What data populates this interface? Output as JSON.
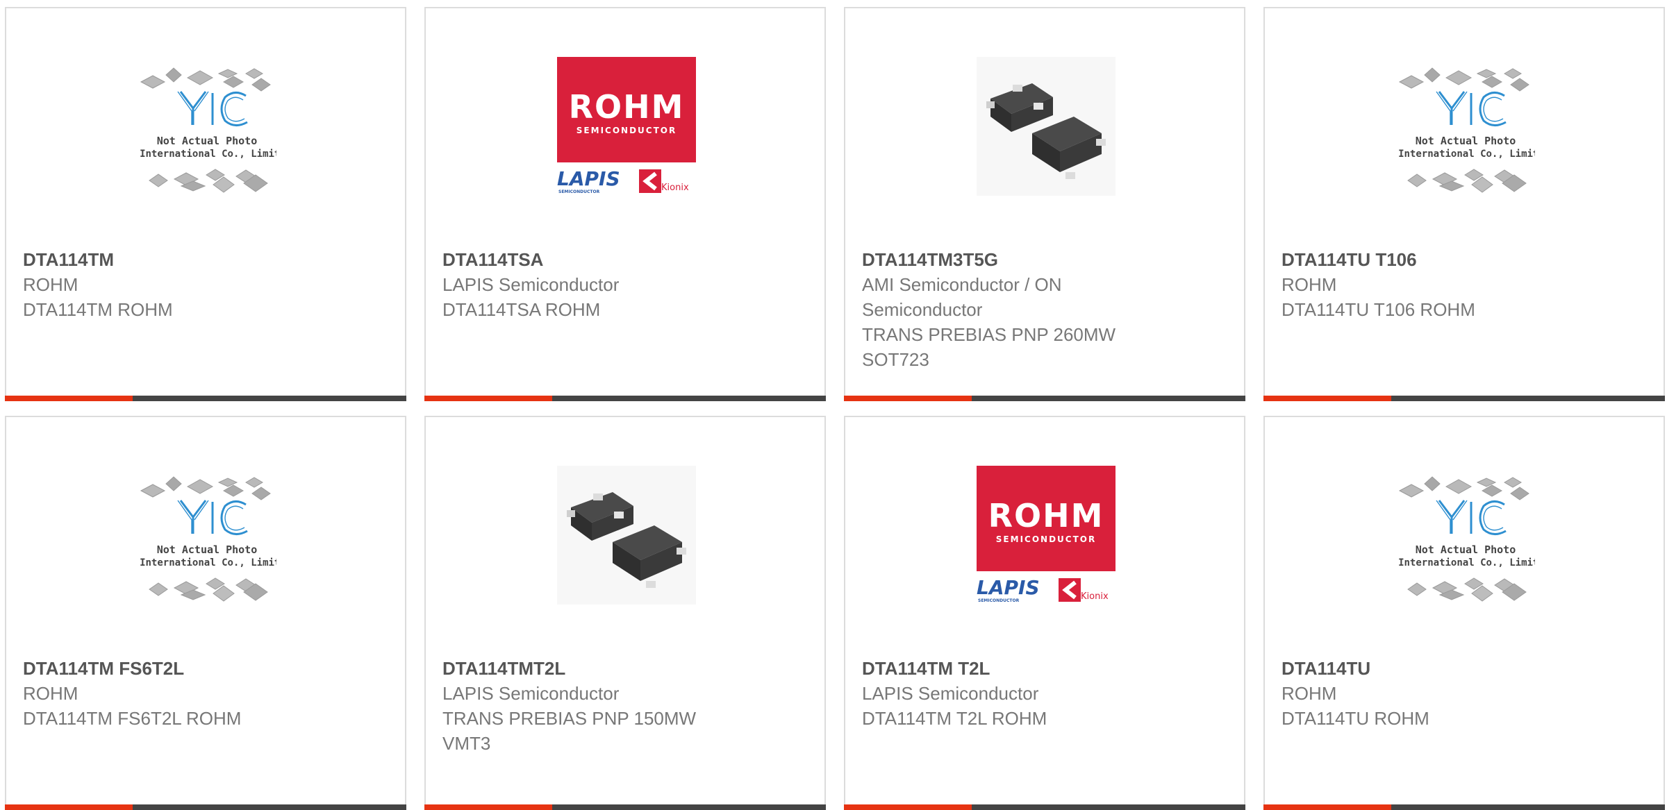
{
  "colors": {
    "accent": "#e63312",
    "bar": "#444444",
    "rohm_red": "#d9203b",
    "lapis_blue": "#2a5aa8",
    "yic_blue": "#2e8fd0"
  },
  "placeholder": {
    "line1": "Not Actual Photo",
    "line2": "YIC International Co., Limited.",
    "brand": "YIC"
  },
  "rohm_logo": {
    "brand": "ROHM",
    "sub": "SEMICONDUCTOR",
    "lapis": "LAPIS",
    "lapis_sub": "SEMICONDUCTOR",
    "kionix": "Kionix"
  },
  "products": [
    {
      "part": "DTA114TM",
      "lines": [
        "ROHM",
        "DTA114TM ROHM"
      ],
      "image": "yic-placeholder"
    },
    {
      "part": "DTA114TSA",
      "lines": [
        "LAPIS Semiconductor",
        "DTA114TSA ROHM"
      ],
      "image": "rohm-logo"
    },
    {
      "part": "DTA114TM3T5G",
      "lines": [
        "AMI Semiconductor / ON",
        "Semiconductor",
        "TRANS PREBIAS PNP 260MW",
        "SOT723"
      ],
      "image": "chip-photo"
    },
    {
      "part": "DTA114TU T106",
      "lines": [
        "ROHM",
        "DTA114TU T106 ROHM"
      ],
      "image": "yic-placeholder"
    },
    {
      "part": "DTA114TM FS6T2L",
      "lines": [
        "ROHM",
        "DTA114TM FS6T2L ROHM"
      ],
      "image": "yic-placeholder"
    },
    {
      "part": "DTA114TMT2L",
      "lines": [
        "LAPIS Semiconductor",
        "TRANS PREBIAS PNP 150MW",
        "VMT3"
      ],
      "image": "chip-photo"
    },
    {
      "part": "DTA114TM T2L",
      "lines": [
        "LAPIS Semiconductor",
        "DTA114TM T2L ROHM"
      ],
      "image": "rohm-logo"
    },
    {
      "part": "DTA114TU",
      "lines": [
        "ROHM",
        "DTA114TU ROHM"
      ],
      "image": "yic-placeholder"
    }
  ]
}
